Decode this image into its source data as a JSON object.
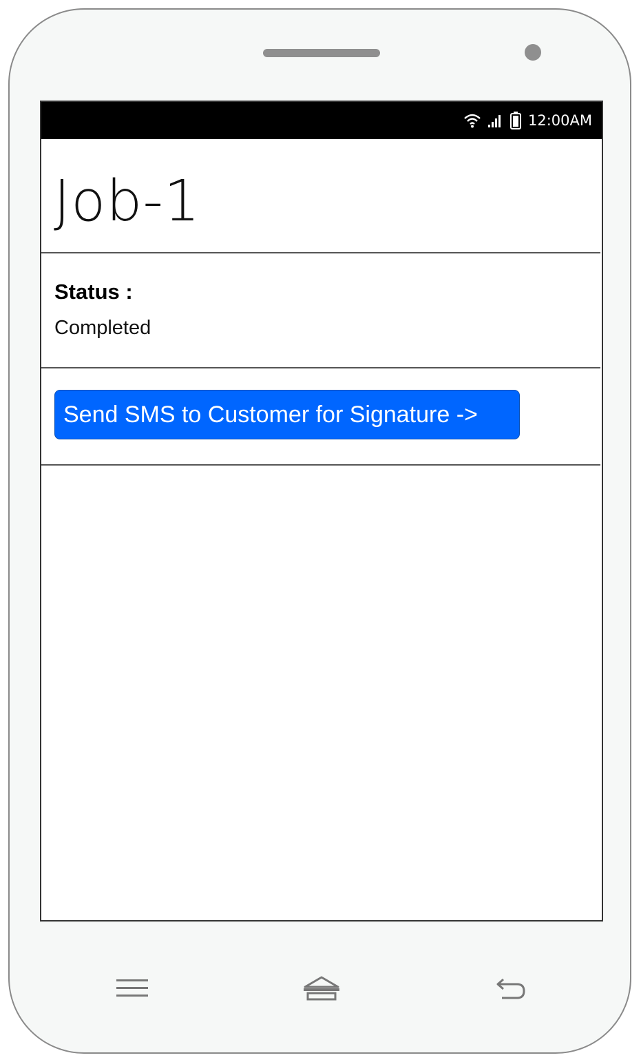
{
  "status_bar": {
    "time": "12:00AM",
    "icons": [
      "wifi-icon",
      "signal-icon",
      "battery-icon"
    ]
  },
  "job": {
    "title": "Job-1",
    "status_label": "Status :",
    "status_value": "Completed"
  },
  "actions": {
    "send_sms_label": "Send SMS to Customer for Signature ->"
  },
  "nav_bar": {
    "icons": [
      "menu-icon",
      "home-icon",
      "back-icon"
    ]
  },
  "colors": {
    "accent": "#0066ff",
    "status_bar": "#000000",
    "device_body": "#f6f8f7"
  }
}
